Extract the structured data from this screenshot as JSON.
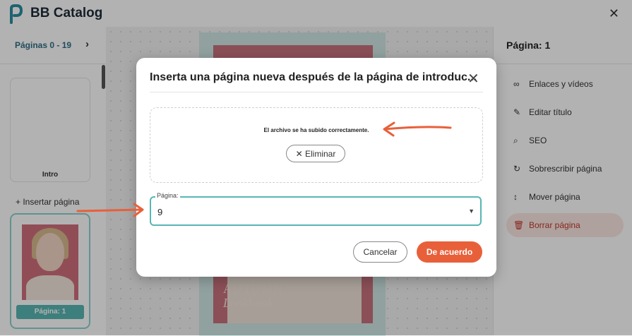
{
  "app": {
    "title": "BB Catalog",
    "close_icon": "close-icon"
  },
  "sidebar": {
    "pages_range": "Páginas 0 - 19",
    "chevron": "›",
    "intro_label": "Intro",
    "insert_page": "+ Insertar página",
    "page_badge": "Página: 1"
  },
  "preview": {
    "title": "AUTUMN",
    "subtitle": "Lookbook"
  },
  "right_panel": {
    "title": "Página: 1",
    "items": [
      {
        "label": "Enlaces y vídeos",
        "icon": "link-icon"
      },
      {
        "label": "Editar título",
        "icon": "pencil-icon"
      },
      {
        "label": "SEO",
        "icon": "seo-search-icon"
      },
      {
        "label": "Sobrescribir página",
        "icon": "refresh-icon"
      },
      {
        "label": "Mover página",
        "icon": "move-icon"
      },
      {
        "label": "Borrar página",
        "icon": "trash-icon"
      }
    ]
  },
  "modal": {
    "title": "Inserta una página nueva después de la página de introduc...",
    "upload_message": "El archivo se ha subido correctamente.",
    "remove_label": "✕ Eliminar",
    "page_field_label": "Página:",
    "page_field_value": "9",
    "cancel_label": "Cancelar",
    "ok_label": "De acuerdo"
  },
  "colors": {
    "accent": "#58b6b3",
    "primary_button": "#e8603a",
    "annotation": "#e8603a"
  }
}
